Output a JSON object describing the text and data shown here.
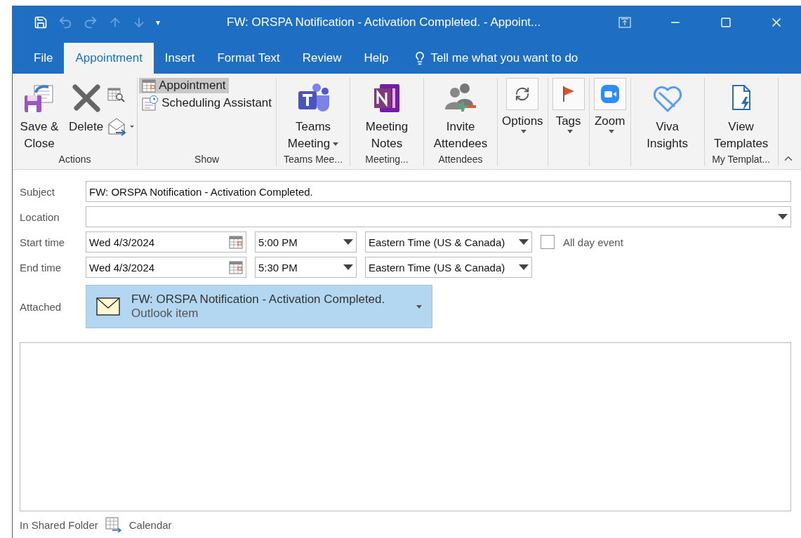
{
  "window": {
    "title": "FW: ORSPA Notification - Activation Completed.  - Appoint...",
    "quick_access_menu": "▾"
  },
  "tabs": [
    {
      "label": "File",
      "selected": false
    },
    {
      "label": "Appointment",
      "selected": true
    },
    {
      "label": "Insert",
      "selected": false
    },
    {
      "label": "Format Text",
      "selected": false
    },
    {
      "label": "Review",
      "selected": false
    },
    {
      "label": "Help",
      "selected": false
    }
  ],
  "tell_me": {
    "placeholder": "Tell me what you want to do"
  },
  "ribbon": {
    "groups": [
      {
        "label": "Actions",
        "items": [
          {
            "kind": "large",
            "label": "Save & Close"
          },
          {
            "kind": "large",
            "label": "Delete"
          },
          {
            "kind": "stack"
          }
        ]
      },
      {
        "label": "Show",
        "items": [
          {
            "kind": "small",
            "label": "Appointment",
            "selected": true
          },
          {
            "kind": "small",
            "label": "Scheduling Assistant",
            "selected": false
          }
        ]
      },
      {
        "label": "Teams Mee...",
        "items": [
          {
            "kind": "large",
            "label": "Teams Meeting",
            "dropdown": true
          }
        ]
      },
      {
        "label": "Meeting...",
        "items": [
          {
            "kind": "large",
            "label": "Meeting Notes"
          }
        ]
      },
      {
        "label": "Attendees",
        "items": [
          {
            "kind": "large",
            "label": "Invite Attendees"
          }
        ]
      },
      {
        "items": [
          {
            "kind": "boxed",
            "label": "Options",
            "dropdown": true
          }
        ]
      },
      {
        "items": [
          {
            "kind": "boxed",
            "label": "Tags",
            "dropdown": true
          }
        ]
      },
      {
        "items": [
          {
            "kind": "boxed",
            "label": "Zoom",
            "dropdown": true
          }
        ]
      },
      {
        "items": [
          {
            "kind": "large",
            "label": "Viva Insights"
          }
        ]
      },
      {
        "label": "My Templat...",
        "items": [
          {
            "kind": "large",
            "label": "View Templates"
          }
        ]
      }
    ]
  },
  "form": {
    "subject": {
      "label": "Subject",
      "value": "FW: ORSPA Notification - Activation Completed."
    },
    "location": {
      "label": "Location"
    },
    "times": [
      {
        "label": "Start time",
        "date": "Wed 4/3/2024",
        "time": "5:00 PM",
        "timezone": "Eastern Time (US & Canada)"
      },
      {
        "label": "End time",
        "date": "Wed 4/3/2024",
        "time": "5:30 PM",
        "timezone": "Eastern Time (US & Canada)"
      }
    ],
    "all_day": {
      "label": "All day event",
      "checked": false
    },
    "attached": {
      "label": "Attached",
      "title": "FW: ORSPA Notification - Activation Completed.",
      "subtitle": "Outlook item"
    }
  },
  "footer": {
    "label": "In Shared Folder",
    "folder": "Calendar"
  }
}
